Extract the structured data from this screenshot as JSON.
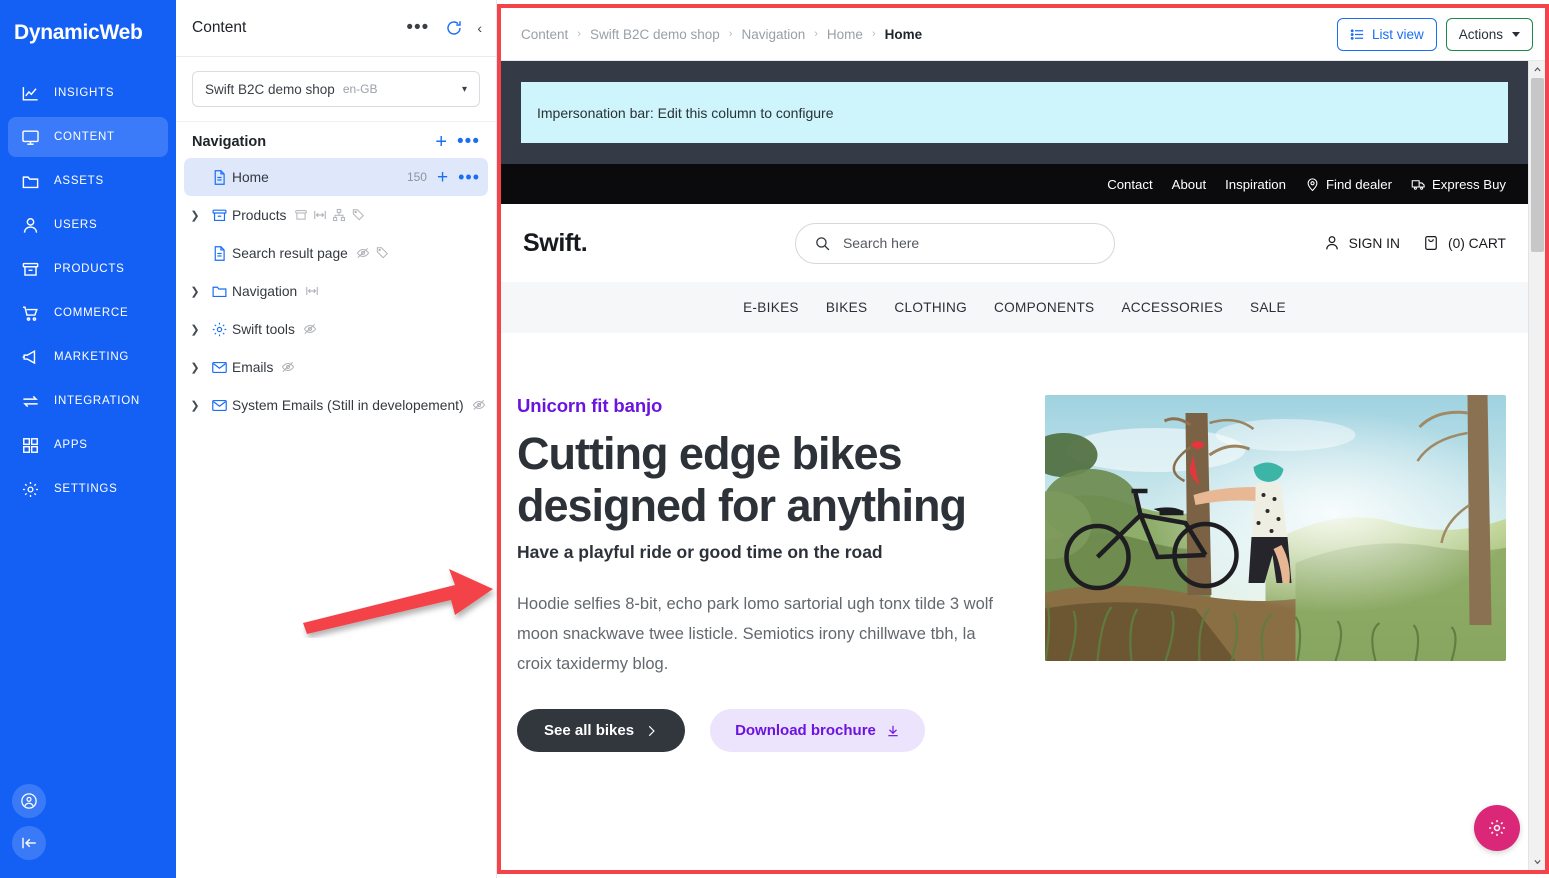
{
  "app": {
    "brand": "DynamicWeb",
    "accent_blue": "#1460f5",
    "accent_pink": "#db2777",
    "annotation_color": "#f4434a"
  },
  "sidebar": {
    "items": [
      {
        "label": "INSIGHTS",
        "icon": "chart-line-icon",
        "active": false
      },
      {
        "label": "CONTENT",
        "icon": "monitor-icon",
        "active": true
      },
      {
        "label": "ASSETS",
        "icon": "folder-icon",
        "active": false
      },
      {
        "label": "USERS",
        "icon": "user-icon",
        "active": false
      },
      {
        "label": "PRODUCTS",
        "icon": "box-icon",
        "active": false
      },
      {
        "label": "COMMERCE",
        "icon": "cart-icon",
        "active": false
      },
      {
        "label": "MARKETING",
        "icon": "megaphone-icon",
        "active": false
      },
      {
        "label": "INTEGRATION",
        "icon": "arrows-exchange-icon",
        "active": false
      },
      {
        "label": "APPS",
        "icon": "grid-icon",
        "active": false
      },
      {
        "label": "SETTINGS",
        "icon": "gear-icon",
        "active": false
      }
    ],
    "bottom": [
      {
        "icon": "account-circle-icon"
      },
      {
        "icon": "collapse-panel-icon"
      }
    ]
  },
  "tree_panel": {
    "title": "Content",
    "more_label": "•••",
    "refresh_icon": "refresh-icon",
    "collapse_icon": "chevron-left-icon",
    "site_picker": {
      "name": "Swift B2C demo shop",
      "locale": "en-GB",
      "caret": "chevron-down-icon"
    },
    "section": {
      "title": "Navigation",
      "add_label": "+",
      "more_label": "•••"
    },
    "items": [
      {
        "label": "Home",
        "icon": "page-icon",
        "selected": true,
        "expandable": false,
        "count": "150",
        "add_label": "+",
        "more_label": "•••",
        "badges": []
      },
      {
        "label": "Products",
        "icon": "box-icon",
        "selected": false,
        "expandable": true,
        "count": "",
        "badges": [
          "box-icon",
          "resize-icon",
          "sitemap-icon",
          "tag-icon"
        ]
      },
      {
        "label": "Search result page",
        "icon": "page-icon",
        "selected": false,
        "expandable": false,
        "count": "",
        "badges": [
          "eye-off-icon",
          "tag-icon"
        ]
      },
      {
        "label": "Navigation",
        "icon": "folder-icon",
        "selected": false,
        "expandable": true,
        "count": "",
        "badges": [
          "resize-icon"
        ]
      },
      {
        "label": "Swift tools",
        "icon": "gear-icon",
        "selected": false,
        "expandable": true,
        "count": "",
        "badges": [
          "eye-off-icon"
        ]
      },
      {
        "label": "Emails",
        "icon": "mail-icon",
        "selected": false,
        "expandable": true,
        "count": "",
        "badges": [
          "eye-off-icon"
        ]
      },
      {
        "label": "System Emails (Still in developement)",
        "icon": "mail-icon",
        "selected": false,
        "expandable": true,
        "count": "",
        "badges": [
          "eye-off-icon"
        ]
      }
    ]
  },
  "preview": {
    "breadcrumb": [
      "Content",
      "Swift B2C demo shop",
      "Navigation",
      "Home",
      "Home"
    ],
    "breadcrumb_sep": "›",
    "list_view_button": "List view",
    "list_view_icon": "list-icon",
    "actions_button": "Actions",
    "impersonation_bar": "Impersonation bar: Edit this column to configure",
    "util_links": [
      {
        "label": "Contact",
        "icon": ""
      },
      {
        "label": "About",
        "icon": ""
      },
      {
        "label": "Inspiration",
        "icon": ""
      },
      {
        "label": "Find dealer",
        "icon": "map-pin-icon"
      },
      {
        "label": "Express Buy",
        "icon": "truck-icon"
      }
    ],
    "shop": {
      "logo": "Swift.",
      "search_placeholder": "Search here",
      "search_icon": "search-icon",
      "sign_in": "SIGN IN",
      "sign_in_icon": "user-icon",
      "cart": "(0) CART",
      "cart_icon": "bag-icon"
    },
    "categories": [
      "E-BIKES",
      "BIKES",
      "CLOTHING",
      "COMPONENTS",
      "ACCESSORIES",
      "SALE"
    ],
    "hero": {
      "eyebrow": "Unicorn fit banjo",
      "heading": "Cutting edge bikes designed for anything",
      "subheading": "Have a playful ride or good time on the road",
      "paragraph": "Hoodie selfies 8-bit, echo park lomo sartorial ugh tonx tilde 3 wolf moon snackwave twee listicle. Semiotics irony chillwave tbh, la croix taxidermy blog.",
      "primary_cta": "See all bikes",
      "primary_cta_icon": "chevron-right-icon",
      "secondary_cta": "Download brochure",
      "secondary_cta_icon": "download-icon",
      "image_alt": "cyclist leaning on tree beside mountain bike on a forest hillside"
    },
    "scrollbar": {
      "up_icon": "chevron-up-icon",
      "down_icon": "chevron-down-icon"
    },
    "fab_icon": "gear-icon"
  }
}
